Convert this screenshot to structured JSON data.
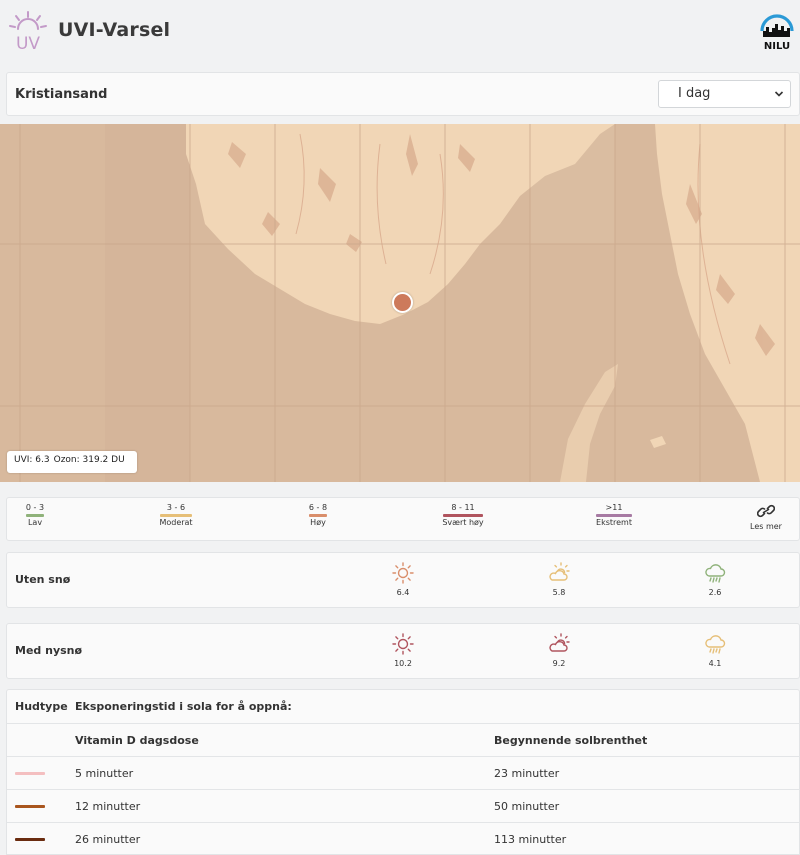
{
  "app": {
    "title": "UVI-Varsel",
    "logo_text": "UV",
    "nilu_text": "NILU"
  },
  "location": {
    "name": "Kristiansand",
    "day_selected": "I dag"
  },
  "map": {
    "uvi_text": "UVI: 6.3",
    "ozone_text": "Ozon: 319.2 DU"
  },
  "legend": {
    "items": [
      {
        "range": "0 - 3",
        "label": "Lav",
        "color": "#8fb27a"
      },
      {
        "range": "3 - 6",
        "label": "Moderat",
        "color": "#e6bf78"
      },
      {
        "range": "6 - 8",
        "label": "Høy",
        "color": "#d98e6b"
      },
      {
        "range": "8 - 11",
        "label": "Svært høy",
        "color": "#b0545e"
      },
      {
        "range": ">11",
        "label": "Ekstremt",
        "color": "#a77aa3"
      }
    ],
    "more_label": "Les mer",
    "more_icon": "link-icon"
  },
  "forecast": {
    "uten_sno": {
      "label": "Uten snø",
      "cells": [
        {
          "icon": "sun-icon",
          "value": "6.4",
          "color": "#d98e6b"
        },
        {
          "icon": "partly-cloudy-icon",
          "value": "5.8",
          "color": "#e6bf78"
        },
        {
          "icon": "rain-cloud-icon",
          "value": "2.6",
          "color": "#8fb27a"
        }
      ]
    },
    "med_nysno": {
      "label": "Med nysnø",
      "cells": [
        {
          "icon": "sun-icon",
          "value": "10.2",
          "color": "#b0545e"
        },
        {
          "icon": "partly-cloudy-icon",
          "value": "9.2",
          "color": "#b0545e"
        },
        {
          "icon": "rain-cloud-icon",
          "value": "4.1",
          "color": "#e6bf78"
        }
      ]
    }
  },
  "exposure": {
    "header_skin": "Hudtype",
    "header_desc": "Eksponeringstid i sola for å oppnå:",
    "col_vitd": "Vitamin D dagsdose",
    "col_burn": "Begynnende solbrenthet",
    "rows": [
      {
        "skin_color": "#f4bfc0",
        "vitd": "5 minutter",
        "burn": "23 minutter"
      },
      {
        "skin_color": "#a9561e",
        "vitd": "12 minutter",
        "burn": "50 minutter"
      },
      {
        "skin_color": "#6a2c10",
        "vitd": "26 minutter",
        "burn": "113 minutter"
      }
    ]
  }
}
